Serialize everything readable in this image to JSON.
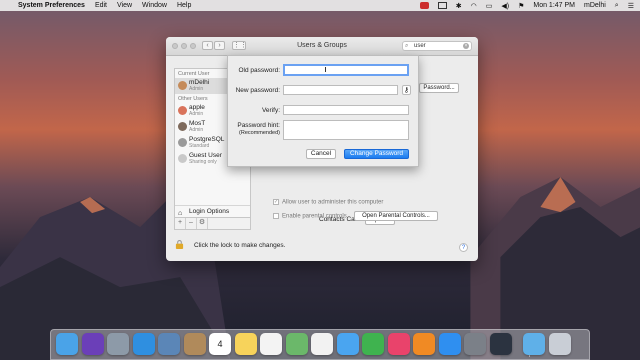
{
  "menubar": {
    "app_name": "System Preferences",
    "menus": [
      "Edit",
      "View",
      "Window",
      "Help"
    ],
    "clock": "Mon 1:47 PM",
    "user": "mDelhi"
  },
  "window": {
    "title": "Users & Groups",
    "search_value": "user"
  },
  "sidebar": {
    "current_user_header": "Current User",
    "other_users_header": "Other Users",
    "current_user": {
      "name": "mDelhi",
      "role": "Admin"
    },
    "other_users": [
      {
        "name": "apple",
        "role": "Admin"
      },
      {
        "name": "MosT",
        "role": "Admin"
      },
      {
        "name": "PostgreSQL",
        "role": "Standard"
      },
      {
        "name": "Guest User",
        "role": "Sharing only"
      }
    ],
    "login_options": "Login Options",
    "add_label": "+",
    "remove_label": "–",
    "gear_label": "⚙"
  },
  "main": {
    "password_button": "Password...",
    "contacts_card_label": "Contacts Card:",
    "open_button": "Open...",
    "allow_admin_label": "Allow user to administer this computer",
    "parental_label": "Enable parental controls",
    "open_parental_button": "Open Parental Controls...",
    "lock_text": "Click the lock to make changes.",
    "help": "?"
  },
  "sheet": {
    "old_password_label": "Old password:",
    "old_password_value": "",
    "new_password_label": "New password:",
    "new_password_value": "",
    "verify_label": "Verify:",
    "verify_value": "",
    "hint_label": "Password hint:",
    "hint_sublabel": "(Recommended)",
    "hint_value": "",
    "cancel_button": "Cancel",
    "change_button": "Change Password"
  },
  "dock": {
    "icons": [
      {
        "name": "finder-icon",
        "color": "#4aa3e8"
      },
      {
        "name": "siri-icon",
        "color": "#6b3fb8"
      },
      {
        "name": "launchpad-icon",
        "color": "#8d9aa8"
      },
      {
        "name": "safari-icon",
        "color": "#2f8fe0"
      },
      {
        "name": "preview-icon",
        "color": "#5b86b7"
      },
      {
        "name": "contacts-icon",
        "color": "#b08a5b"
      },
      {
        "name": "calendar-icon",
        "color": "#ffffff"
      },
      {
        "name": "notes-icon",
        "color": "#f7d35b"
      },
      {
        "name": "reminders-icon",
        "color": "#f3f3f3"
      },
      {
        "name": "maps-icon",
        "color": "#6bb86a"
      },
      {
        "name": "photos-icon",
        "color": "#f2f2f2"
      },
      {
        "name": "messages-icon",
        "color": "#4aa5f0"
      },
      {
        "name": "facetime-icon",
        "color": "#3fb34f"
      },
      {
        "name": "itunes-icon",
        "color": "#e9436b"
      },
      {
        "name": "ibooks-icon",
        "color": "#f08a24"
      },
      {
        "name": "app-store-icon",
        "color": "#2f8ff0"
      },
      {
        "name": "system-preferences-icon",
        "color": "#7b8088"
      },
      {
        "name": "quicktime-icon",
        "color": "#2b3340"
      },
      {
        "name": "downloads-folder-icon",
        "color": "#5fb0e8"
      },
      {
        "name": "trash-icon",
        "color": "#c9ced6"
      }
    ],
    "calendar_day": "4"
  }
}
